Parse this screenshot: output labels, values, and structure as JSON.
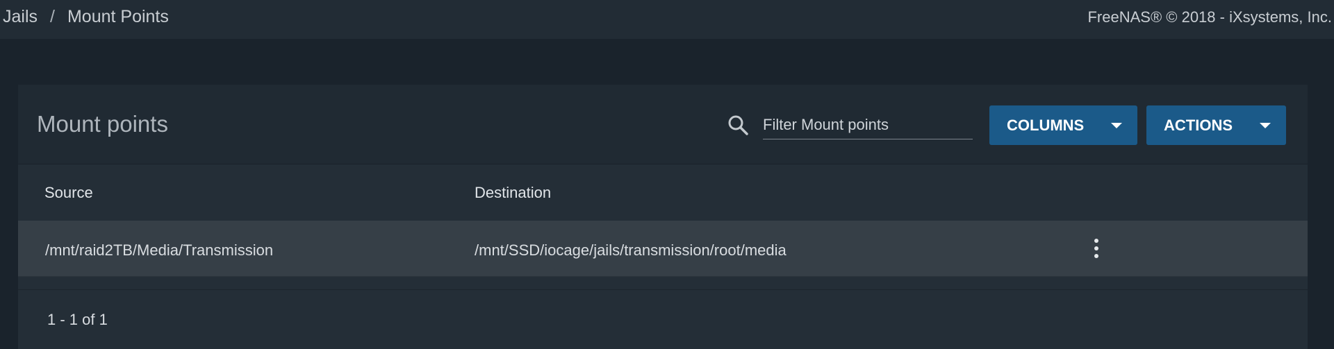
{
  "breadcrumb": {
    "items": [
      "Jails",
      "Mount Points"
    ],
    "separator": "/"
  },
  "copyright": "FreeNAS® © 2018 - iXsystems, Inc.",
  "card": {
    "title": "Mount points",
    "filter": {
      "placeholder": "Filter Mount points",
      "value": "",
      "icon": "search-icon"
    },
    "buttons": {
      "columns": "COLUMNS",
      "actions": "ACTIONS"
    },
    "table": {
      "columns": [
        "Source",
        "Destination"
      ],
      "rows": [
        {
          "source": "/mnt/raid2TB/Media/Transmission",
          "destination": "/mnt/SSD/iocage/jails/transmission/root/media"
        }
      ]
    },
    "pagination": "1 - 1 of 1"
  },
  "colors": {
    "background": "#1a232c",
    "topbar": "#222c35",
    "card": "#242e37",
    "button": "#1b5a89",
    "row_highlight": "#363f47"
  }
}
